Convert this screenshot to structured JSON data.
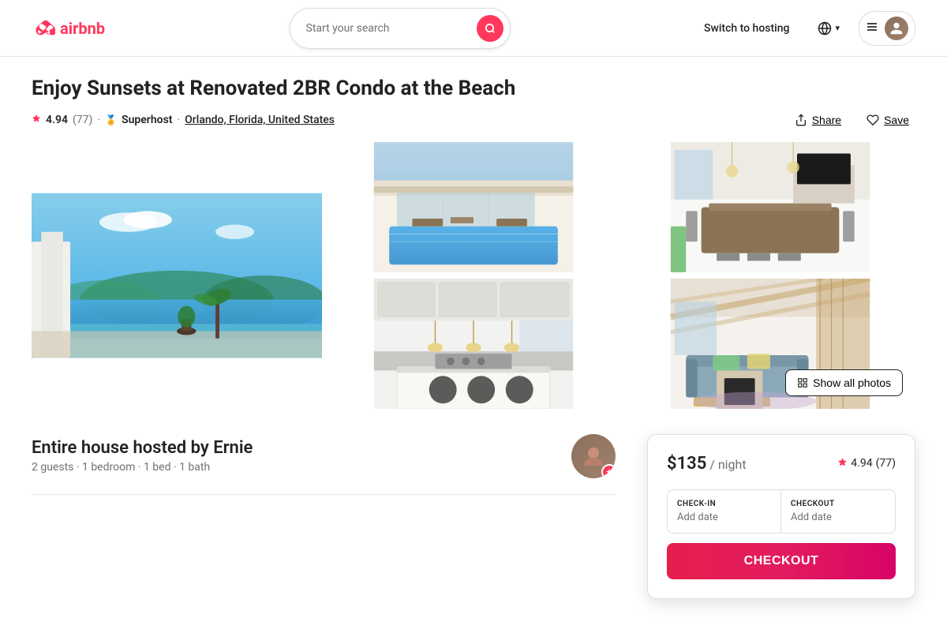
{
  "header": {
    "logo_text": "airbnb",
    "search_placeholder": "Start your search",
    "switch_hosting": "Switch to hosting",
    "globe_icon": "🌐",
    "chevron": "▾"
  },
  "listing": {
    "title": "Enjoy Sunsets at Renovated 2BR Condo at the Beach",
    "rating": "4.94",
    "review_count": "77",
    "superhost_label": "Superhost",
    "location": "Orlando, Florida, United States",
    "share_label": "Share",
    "save_label": "Save",
    "show_photos_label": "Show all photos"
  },
  "host": {
    "hosted_by": "Entire house hosted by Ernie",
    "details": "2 guests · 1 bedroom · 1 bed · 1 bath"
  },
  "booking": {
    "price": "$135",
    "per_night": "/ night",
    "rating": "4.94",
    "review_count": "77",
    "checkin_label": "CHECK-IN",
    "checkout_label": "CHECKOUT",
    "checkin_value": "Add date",
    "checkout_value": "Add date",
    "checkout_btn": "CHECKOUT"
  },
  "photos": {
    "main_alt": "Beautiful oceanview infinity pool",
    "top_right_alt": "Modern exterior with pool",
    "top_far_alt": "Bright dining room interior",
    "bottom_right_alt": "Modern kitchen",
    "bottom_far_alt": "Living room with high ceilings"
  }
}
